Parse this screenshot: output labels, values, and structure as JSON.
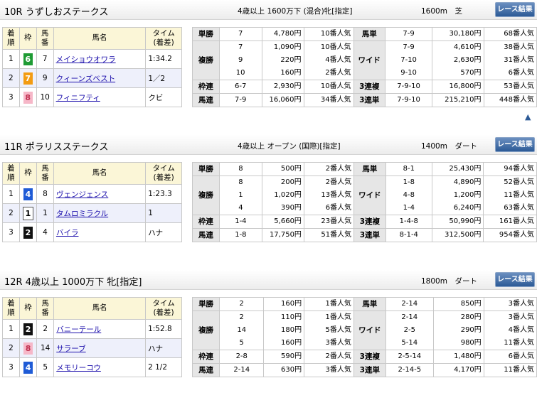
{
  "header_labels": {
    "button": "レース結果"
  },
  "result_head": {
    "pos": [
      "着",
      "順"
    ],
    "wk": "枠",
    "no": [
      "馬",
      "番"
    ],
    "name": "馬名",
    "time": [
      "タイム",
      "(着差)"
    ]
  },
  "pay_labels": {
    "tan": "単勝",
    "fuku": "複勝",
    "waku": "枠連",
    "uren": "馬連",
    "utan": "馬単",
    "wide": "ワイド",
    "trio": "3連複",
    "tri": "3連単"
  },
  "up_icon": "▲",
  "colors": {
    "w1": "#ffffff",
    "w2": "#111111",
    "w4": "#1f5bd6",
    "w6": "#1e9b34",
    "w7": "#f39c12",
    "w8": "#f6b7c8",
    "button": "#2c5a96",
    "header_bg": "#fbf6d7"
  },
  "races": [
    {
      "title": "10R うずしおステークス",
      "cond": "4歳以上 1600万下 (混合)牝[指定]",
      "dist": "1600m　芝",
      "results": [
        {
          "pos": "1",
          "wk": "6",
          "no": "7",
          "name": "メイショウオワラ",
          "time": "1:34.2"
        },
        {
          "pos": "2",
          "wk": "7",
          "no": "9",
          "name": "クィーンズベスト",
          "time": "1／2"
        },
        {
          "pos": "3",
          "wk": "8",
          "no": "10",
          "name": "フィニフティ",
          "time": "クビ"
        }
      ],
      "tan": {
        "nums": "7",
        "yen": "4,780円",
        "pop": "10番人気"
      },
      "fuku": {
        "nums": [
          "7",
          "9",
          "10"
        ],
        "yen": [
          "1,090円",
          "220円",
          "160円"
        ],
        "pop": [
          "10番人気",
          "4番人気",
          "2番人気"
        ]
      },
      "waku": {
        "nums": "6-7",
        "yen": "2,930円",
        "pop": "10番人気"
      },
      "uren": {
        "nums": "7-9",
        "yen": "16,060円",
        "pop": "34番人気"
      },
      "utan": {
        "nums": "7-9",
        "yen": "30,180円",
        "pop": "68番人気"
      },
      "wide": {
        "nums": [
          "7-9",
          "7-10",
          "9-10"
        ],
        "yen": [
          "4,610円",
          "2,630円",
          "570円"
        ],
        "pop": [
          "38番人気",
          "31番人気",
          "6番人気"
        ]
      },
      "trio": {
        "nums": "7-9-10",
        "yen": "16,800円",
        "pop": "53番人気"
      },
      "tri": {
        "nums": "7-9-10",
        "yen": "215,210円",
        "pop": "448番人気"
      }
    },
    {
      "title": "11R ポラリスステークス",
      "cond": "4歳以上 オープン (国際)[指定]",
      "dist": "1400m　ダート",
      "results": [
        {
          "pos": "1",
          "wk": "4",
          "no": "8",
          "name": "ヴェンジェンス",
          "time": "1:23.3"
        },
        {
          "pos": "2",
          "wk": "1",
          "no": "1",
          "name": "タムロミラクル",
          "time": "1"
        },
        {
          "pos": "3",
          "wk": "2",
          "no": "4",
          "name": "バイラ",
          "time": "ハナ"
        }
      ],
      "tan": {
        "nums": "8",
        "yen": "500円",
        "pop": "2番人気"
      },
      "fuku": {
        "nums": [
          "8",
          "1",
          "4"
        ],
        "yen": [
          "200円",
          "1,020円",
          "390円"
        ],
        "pop": [
          "2番人気",
          "13番人気",
          "6番人気"
        ]
      },
      "waku": {
        "nums": "1-4",
        "yen": "5,660円",
        "pop": "23番人気"
      },
      "uren": {
        "nums": "1-8",
        "yen": "17,750円",
        "pop": "51番人気"
      },
      "utan": {
        "nums": "8-1",
        "yen": "25,430円",
        "pop": "94番人気"
      },
      "wide": {
        "nums": [
          "1-8",
          "4-8",
          "1-4"
        ],
        "yen": [
          "4,890円",
          "1,200円",
          "6,240円"
        ],
        "pop": [
          "52番人気",
          "11番人気",
          "63番人気"
        ]
      },
      "trio": {
        "nums": "1-4-8",
        "yen": "50,990円",
        "pop": "161番人気"
      },
      "tri": {
        "nums": "8-1-4",
        "yen": "312,500円",
        "pop": "954番人気"
      }
    },
    {
      "title": "12R 4歳以上 1000万下 牝[指定]",
      "cond": "",
      "dist": "1800m　ダート",
      "results": [
        {
          "pos": "1",
          "wk": "2",
          "no": "2",
          "name": "バニーテール",
          "time": "1:52.8"
        },
        {
          "pos": "2",
          "wk": "8",
          "no": "14",
          "name": "サラーブ",
          "time": "ハナ"
        },
        {
          "pos": "3",
          "wk": "4",
          "no": "5",
          "name": "メモリーコウ",
          "time": "2 1/2"
        }
      ],
      "tan": {
        "nums": "2",
        "yen": "160円",
        "pop": "1番人気"
      },
      "fuku": {
        "nums": [
          "2",
          "14",
          "5"
        ],
        "yen": [
          "110円",
          "180円",
          "160円"
        ],
        "pop": [
          "1番人気",
          "5番人気",
          "3番人気"
        ]
      },
      "waku": {
        "nums": "2-8",
        "yen": "590円",
        "pop": "2番人気"
      },
      "uren": {
        "nums": "2-14",
        "yen": "630円",
        "pop": "3番人気"
      },
      "utan": {
        "nums": "2-14",
        "yen": "850円",
        "pop": "3番人気"
      },
      "wide": {
        "nums": [
          "2-14",
          "2-5",
          "5-14"
        ],
        "yen": [
          "280円",
          "290円",
          "980円"
        ],
        "pop": [
          "3番人気",
          "4番人気",
          "11番人気"
        ]
      },
      "trio": {
        "nums": "2-5-14",
        "yen": "1,480円",
        "pop": "6番人気"
      },
      "tri": {
        "nums": "2-14-5",
        "yen": "4,170円",
        "pop": "11番人気"
      }
    }
  ]
}
